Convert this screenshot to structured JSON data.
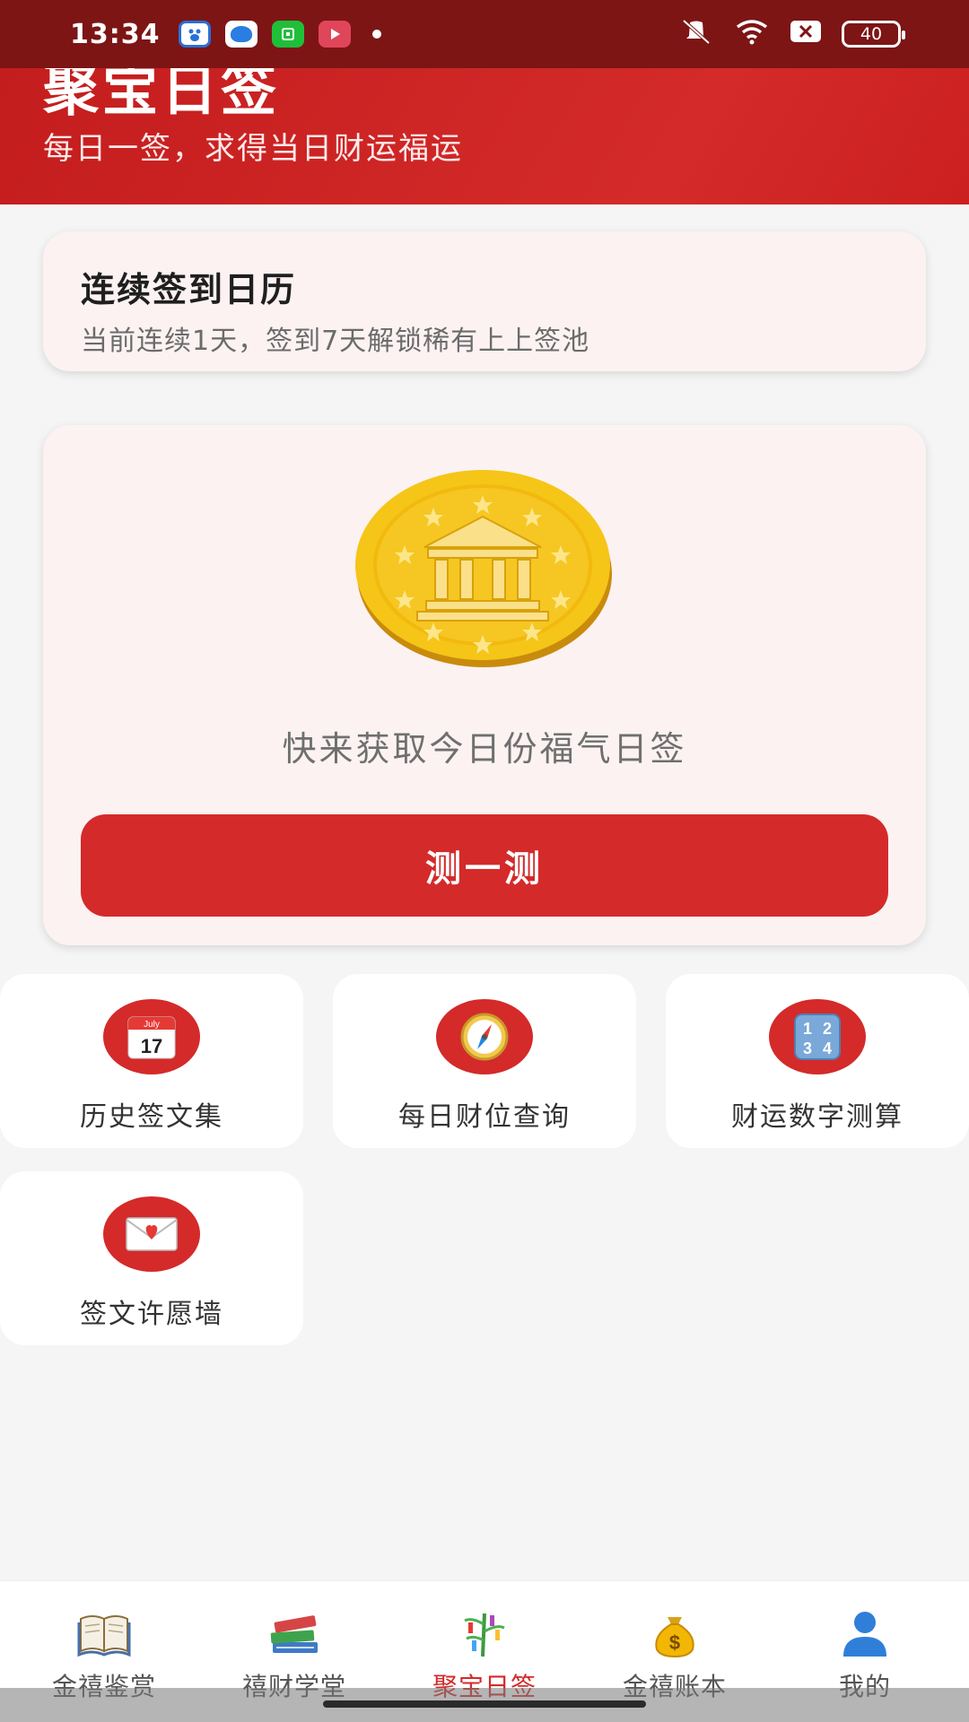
{
  "status_bar": {
    "time": "13:34",
    "battery": "40",
    "app_icons": [
      "baidu-app-icon",
      "browser-app-icon",
      "wechat-app-icon",
      "video-app-icon"
    ]
  },
  "header": {
    "title": "聚宝日签",
    "subtitle": "每日一签，求得当日财运福运",
    "background_color": "#cc2020"
  },
  "streak": {
    "title": "连续签到日历",
    "description": "当前连续1天，签到7天解锁稀有上上签池"
  },
  "main_card": {
    "coin_icon": "gold-coin-bank-icon",
    "prompt": "快来获取今日份福气日签",
    "button_label": "测一测",
    "accent_color": "#d42a2a"
  },
  "features": [
    {
      "label": "历史签文集",
      "icon": "calendar-icon",
      "calendar_month": "July",
      "calendar_day": "17"
    },
    {
      "label": "每日财位查询",
      "icon": "compass-icon"
    },
    {
      "label": "财运数字测算",
      "icon": "numbers-icon",
      "digits": "1234"
    },
    {
      "label": "签文许愿墙",
      "icon": "love-letter-icon"
    }
  ],
  "bottom_nav": {
    "items": [
      {
        "label": "金禧鉴赏",
        "icon": "open-book-icon",
        "active": false
      },
      {
        "label": "禧财学堂",
        "icon": "books-stack-icon",
        "active": false
      },
      {
        "label": "聚宝日签",
        "icon": "tanabata-tree-icon",
        "active": true
      },
      {
        "label": "金禧账本",
        "icon": "money-bag-icon",
        "active": false
      },
      {
        "label": "我的",
        "icon": "person-icon",
        "active": false
      }
    ],
    "active_color": "#d42a2a"
  }
}
